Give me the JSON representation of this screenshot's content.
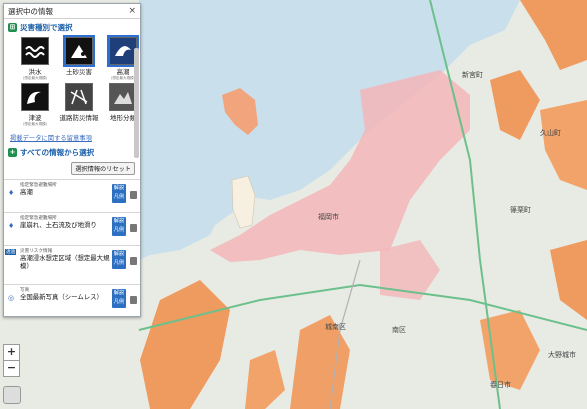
{
  "panel": {
    "title": "選択中の情報",
    "close": "×",
    "by_type_label": "災害種別で選択",
    "hazards": [
      {
        "label": "洪水",
        "sub": "(想定最大規模)",
        "icon": "flood-icon",
        "selected": false
      },
      {
        "label": "土砂災害",
        "sub": "",
        "icon": "landslide-icon",
        "selected": true
      },
      {
        "label": "高潮",
        "sub": "(想定最大規模)",
        "icon": "storm-surge-icon",
        "selected": true
      },
      {
        "label": "津波",
        "sub": "(想定最大規模)",
        "icon": "tsunami-icon",
        "selected": false
      },
      {
        "label": "道路防災情報",
        "sub": "",
        "icon": "road-icon",
        "selected": false
      },
      {
        "label": "地形分類",
        "sub": "",
        "icon": "terrain-icon",
        "selected": false
      }
    ],
    "notes_link": "掲載データに関する留意事項",
    "all_info_label": "すべての情報から選択",
    "reset_label": "選択情報のリセット",
    "legend_label_1": "解説",
    "legend_label_2": "凡例",
    "layers": [
      {
        "category": "指定緊急避難場所",
        "name": "高潮",
        "tag": ""
      },
      {
        "category": "指定緊急避難場所",
        "name": "崖崩れ、土石流及び地滑り",
        "tag": ""
      },
      {
        "category": "災害リスク情報",
        "name": "高潮浸水想定区域（想定最大規模）",
        "tag": "透過"
      },
      {
        "category": "写真",
        "name": "全国最新写真（シームレス）",
        "tag": ""
      }
    ]
  },
  "map": {
    "labels": [
      "福岡市",
      "新宮町",
      "久山町",
      "篠栗町",
      "城南区",
      "南区",
      "春日市",
      "大野城市"
    ],
    "zoom_in": "+",
    "zoom_out": "−"
  }
}
